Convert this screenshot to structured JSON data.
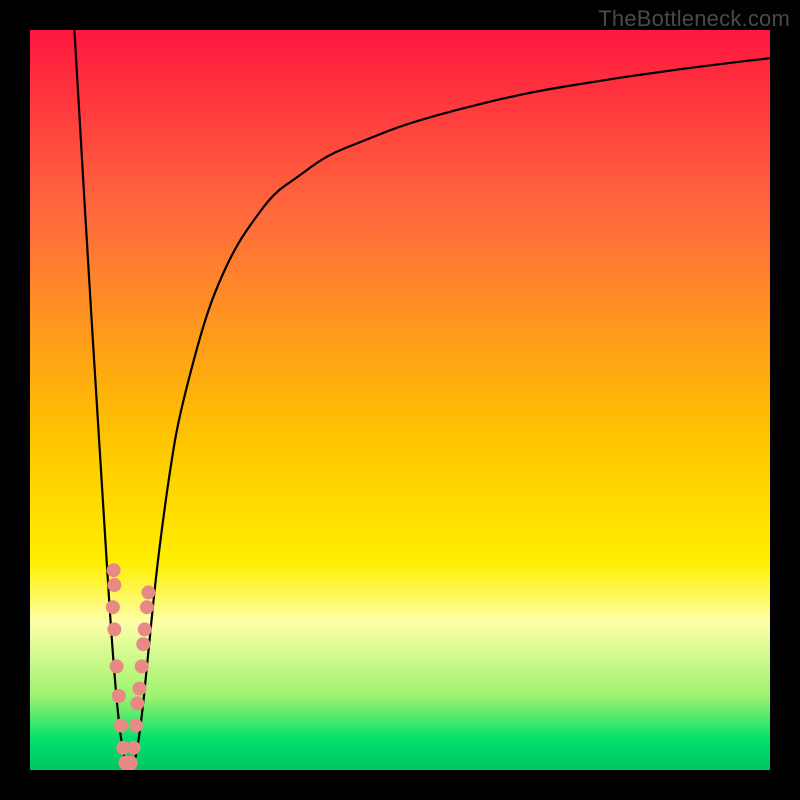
{
  "watermark": "TheBottleneck.com",
  "chart_data": {
    "type": "line",
    "title": "",
    "xlabel": "",
    "ylabel": "",
    "xlim": [
      0,
      100
    ],
    "ylim": [
      0,
      100
    ],
    "grid": false,
    "legend": false,
    "background_gradient_stops": [
      {
        "pct": 0,
        "color": "#ff173f"
      },
      {
        "pct": 25,
        "color": "#ff6a3c"
      },
      {
        "pct": 55,
        "color": "#ffc400"
      },
      {
        "pct": 72,
        "color": "#ffef00"
      },
      {
        "pct": 80,
        "color": "#fdffa8"
      },
      {
        "pct": 90,
        "color": "#9df36f"
      },
      {
        "pct": 96,
        "color": "#00e06a"
      },
      {
        "pct": 100,
        "color": "#00c565"
      }
    ],
    "series": [
      {
        "name": "bottleneck_curve",
        "x": [
          6,
          7,
          8,
          9,
          10,
          11,
          12,
          13,
          14,
          15,
          16,
          17,
          18,
          19,
          20,
          22,
          24,
          26,
          28,
          30,
          33,
          36,
          40,
          45,
          50,
          55,
          60,
          65,
          70,
          75,
          80,
          85,
          90,
          95,
          100
        ],
        "y": [
          100,
          83,
          66,
          50,
          34,
          18,
          6,
          0,
          0,
          6,
          16,
          26,
          34,
          41,
          47,
          55,
          62,
          67,
          71,
          74,
          78,
          80,
          83,
          85,
          87,
          88.5,
          89.8,
          91,
          92,
          92.8,
          93.6,
          94.3,
          95,
          95.6,
          96.2
        ]
      },
      {
        "name": "marker_dots",
        "type": "scatter",
        "color": "#e98986",
        "x": [
          11.2,
          11.4,
          11.7,
          12.0,
          12.3,
          12.6,
          12.9,
          13.3,
          13.6,
          14.0,
          14.3,
          14.5,
          14.8,
          15.1,
          15.3,
          15.5,
          15.8,
          16.0,
          11.3,
          11.4
        ],
        "y": [
          22,
          19,
          14,
          10,
          6,
          3,
          1,
          0,
          1,
          3,
          6,
          9,
          11,
          14,
          17,
          19,
          22,
          24,
          27,
          25
        ]
      }
    ]
  }
}
